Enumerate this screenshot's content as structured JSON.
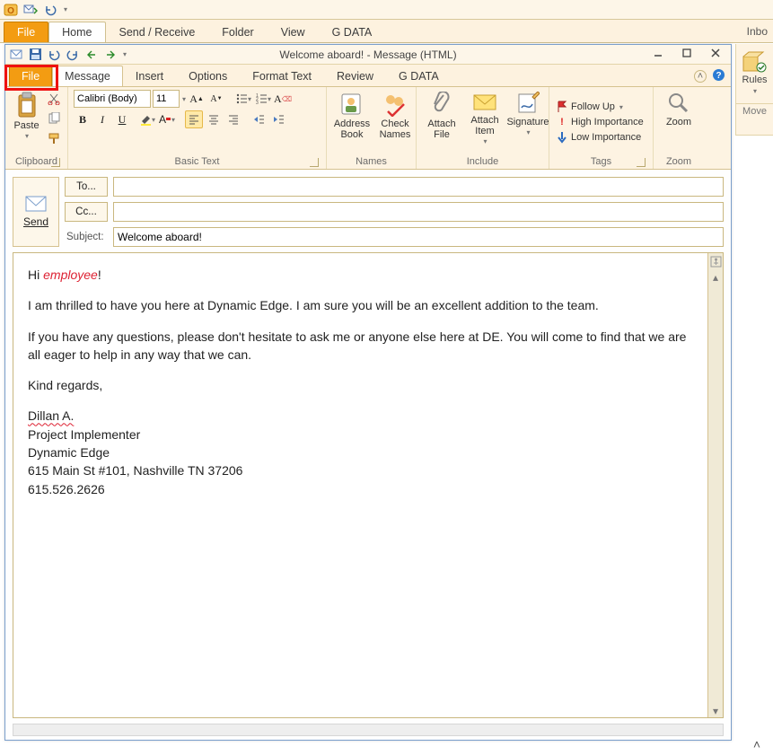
{
  "outer": {
    "tabs": {
      "file": "File",
      "home": "Home",
      "sendreceive": "Send / Receive",
      "folder": "Folder",
      "view": "View",
      "gdata": "G DATA"
    },
    "right_label": "Inbo",
    "right_group": {
      "rules": "Rules",
      "move": "Move"
    }
  },
  "compose": {
    "title": "Welcome aboard!  -  Message (HTML)",
    "tabs": {
      "file": "File",
      "message": "Message",
      "insert": "Insert",
      "options": "Options",
      "format": "Format Text",
      "review": "Review",
      "gdata": "G DATA"
    },
    "ribbon": {
      "clipboard": {
        "paste": "Paste",
        "label": "Clipboard"
      },
      "basictext": {
        "font": "Calibri (Body)",
        "size": "11",
        "label": "Basic Text"
      },
      "names": {
        "address": "Address\nBook",
        "check": "Check\nNames",
        "label": "Names"
      },
      "include": {
        "attachfile": "Attach\nFile",
        "attachitem": "Attach\nItem",
        "signature": "Signature",
        "label": "Include"
      },
      "tags": {
        "followup": "Follow Up",
        "high": "High Importance",
        "low": "Low Importance",
        "label": "Tags"
      },
      "zoom": {
        "zoom": "Zoom",
        "label": "Zoom"
      }
    },
    "fields": {
      "send": "Send",
      "to": "To...",
      "cc": "Cc...",
      "subject_label": "Subject:",
      "to_value": "",
      "cc_value": "",
      "subject_value": "Welcome aboard!"
    },
    "body": {
      "greeting_pre": "Hi ",
      "greeting_token": "employee",
      "greeting_post": "!",
      "para1": "I am thrilled to have you here at Dynamic Edge. I am sure you will be an excellent addition to the team.",
      "para2": "If you have any questions, please don't hesitate to ask me or anyone else here at DE. You will come to find that we are all eager to help in any way that we can.",
      "closing": "Kind regards,",
      "sig_name": "Dillan A.",
      "sig_title": "Project Implementer",
      "sig_company": "Dynamic Edge",
      "sig_addr": "615 Main St #101, Nashville TN 37206",
      "sig_phone": "615.526.2626"
    }
  },
  "colors": {
    "orange": "#f39c12",
    "highlight_red": "#e11"
  }
}
